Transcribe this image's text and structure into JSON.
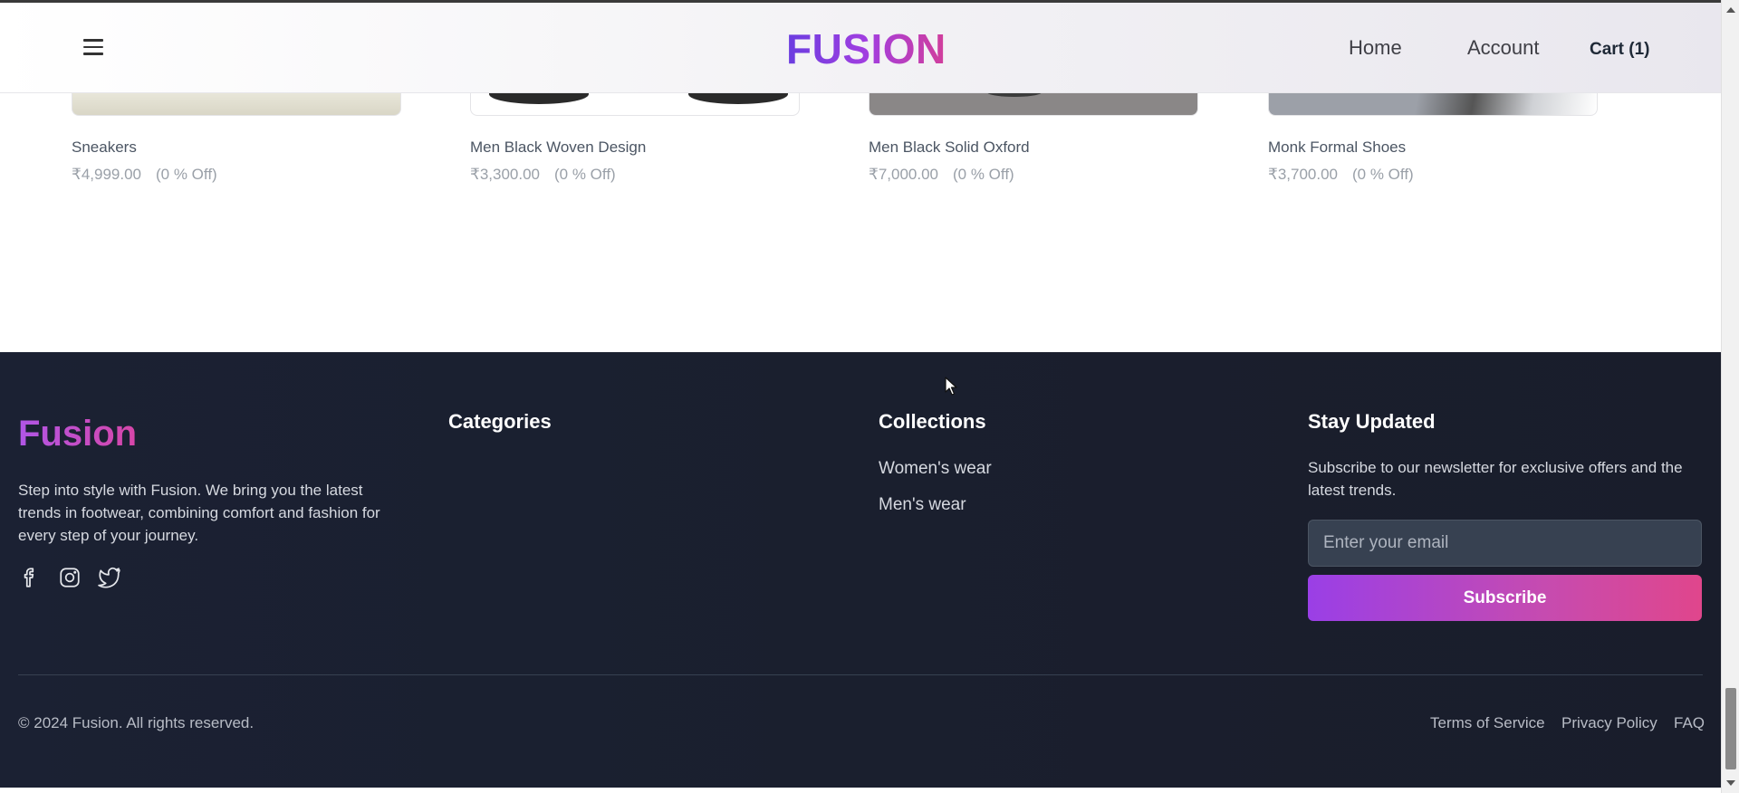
{
  "header": {
    "logo": "FUSION",
    "nav": {
      "home": "Home",
      "account": "Account",
      "cart": "Cart (1)"
    }
  },
  "products": [
    {
      "name": "Sneakers",
      "price": "₹4,999.00",
      "discount": "(0 % Off)"
    },
    {
      "name": "Men Black Woven Design",
      "price": "₹3,300.00",
      "discount": "(0 % Off)"
    },
    {
      "name": "Men Black Solid Oxford",
      "price": "₹7,000.00",
      "discount": "(0 % Off)"
    },
    {
      "name": "Monk Formal Shoes",
      "price": "₹3,700.00",
      "discount": "(0 % Off)"
    }
  ],
  "footer": {
    "brand": "Fusion",
    "description": "Step into style with Fusion. We bring you the latest trends in footwear, combining comfort and fashion for every step of your journey.",
    "social_icons": [
      "facebook-icon",
      "instagram-icon",
      "twitter-icon"
    ],
    "categories_heading": "Categories",
    "collections_heading": "Collections",
    "collections": [
      "Women's wear",
      "Men's wear"
    ],
    "stay_heading": "Stay Updated",
    "stay_description": "Subscribe to our newsletter for exclusive offers and the latest trends.",
    "email_placeholder": "Enter your email",
    "subscribe_label": "Subscribe",
    "copyright": "© 2024 Fusion. All rights reserved.",
    "links": {
      "terms": "Terms of Service",
      "privacy": "Privacy Policy",
      "faq": "FAQ"
    }
  },
  "colors": {
    "brand_gradient_start": "#6a3de0",
    "brand_gradient_end": "#d23e9a",
    "footer_bg": "#1a1f2e",
    "subscribe_start": "#9a3fe6",
    "subscribe_end": "#e0468c"
  }
}
